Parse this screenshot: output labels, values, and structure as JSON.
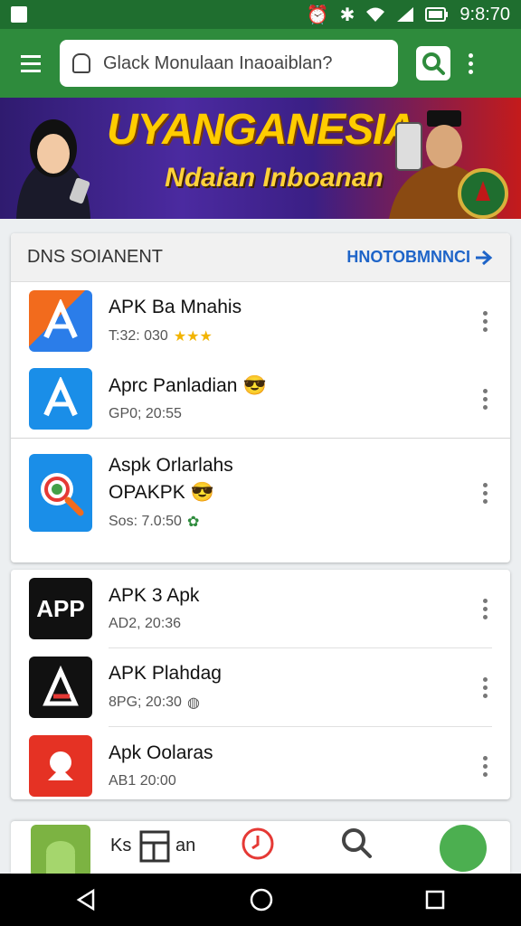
{
  "status_bar": {
    "time": "9:8:70"
  },
  "search": {
    "placeholder": "Glack Monulaan Inaoaiblan?"
  },
  "banner": {
    "title": "UYANGANESIA",
    "subtitle": "Ndaian Inboanan"
  },
  "section_1": {
    "title": "DNS SOIANENT",
    "see_more": "HNOTOBMNNCI",
    "apps": [
      {
        "name": "APK Ba Mnahis",
        "meta": "T:32: 030"
      },
      {
        "name": "Aprc Panladian",
        "meta": "GP0; 20:55"
      },
      {
        "name": "Aspk Orlarlahs",
        "name2": "OPAKPK",
        "meta": "Sos: 7.0:50"
      }
    ]
  },
  "section_2": {
    "apps": [
      {
        "name": "APK 3 Apk",
        "meta": "AD2, 20:36"
      },
      {
        "name": "APK Plahdag",
        "meta": "8PG; 20:30"
      },
      {
        "name": "Apk Oolaras",
        "meta": "AB1 20:00"
      }
    ]
  },
  "bottom_nav": {
    "label_a": "Ks",
    "label_b": "an"
  },
  "colors": {
    "primary": "#2e8b3c",
    "accent": "#1e64c8"
  },
  "icons": [
    "wifi-icon",
    "signal-icon",
    "battery-icon",
    "menu-icon",
    "lock-icon",
    "search-icon",
    "more-vert-icon",
    "arrow-right-icon",
    "back-icon",
    "home-icon",
    "recents-icon"
  ]
}
